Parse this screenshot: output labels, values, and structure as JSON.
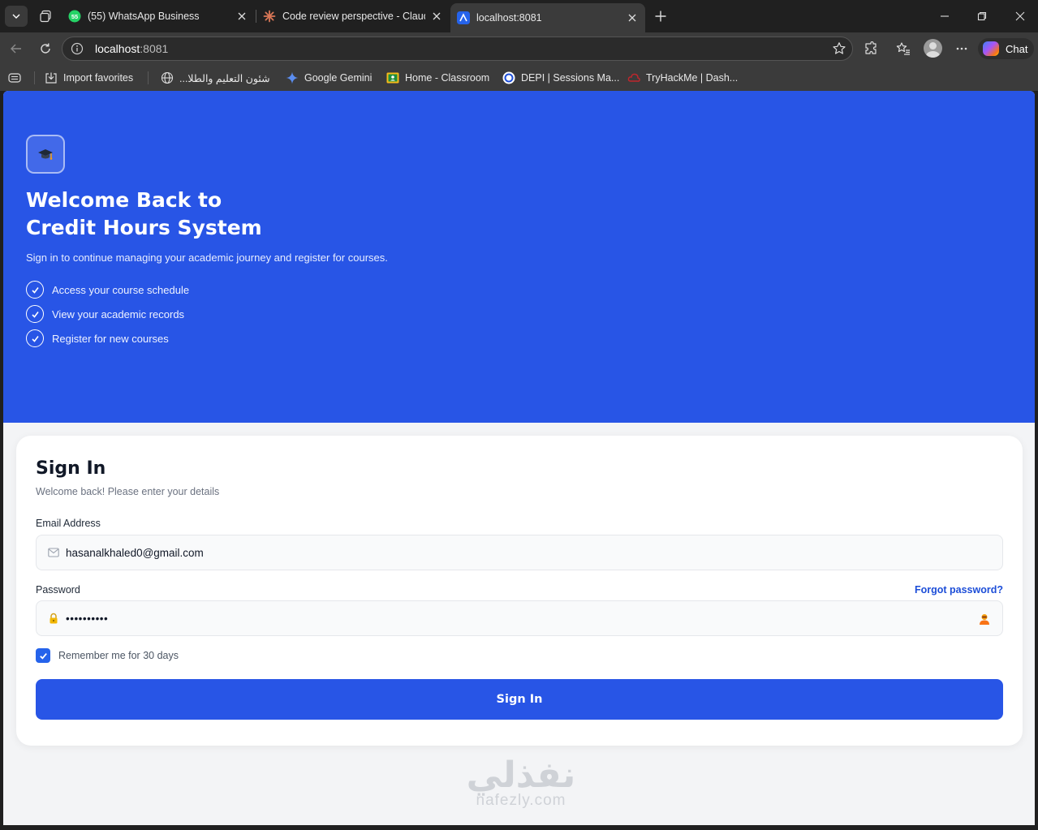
{
  "browser": {
    "tabs": [
      {
        "title": "(55) WhatsApp Business",
        "badge": "55"
      },
      {
        "title": "Code review perspective - Claude"
      },
      {
        "title": "localhost:8081",
        "active": true
      }
    ],
    "address": {
      "host": "localhost",
      "port": ":8081"
    },
    "chat_label": "Chat",
    "bookmarks": [
      {
        "label": "Import favorites",
        "icon": "import-icon"
      },
      {
        "label": "شئون التعليم والطلا...",
        "icon": "globe-icon"
      },
      {
        "label": "Google Gemini",
        "icon": "gemini-icon"
      },
      {
        "label": "Home - Classroom",
        "icon": "classroom-icon"
      },
      {
        "label": "DEPI | Sessions Ma...",
        "icon": "depi-icon"
      },
      {
        "label": "TryHackMe | Dash...",
        "icon": "tryhackme-icon"
      }
    ]
  },
  "hero": {
    "title_line1": "Welcome Back to",
    "title_line2": "Credit Hours System",
    "subtitle": "Sign in to continue managing your academic journey and register for courses.",
    "features": [
      "Access your course schedule",
      "View your academic records",
      "Register for new courses"
    ],
    "colors": {
      "background": "#2855e6"
    }
  },
  "signin": {
    "title": "Sign In",
    "subtitle": "Welcome back! Please enter your details",
    "email_label": "Email Address",
    "email_value": "hasanalkhaled0@gmail.com",
    "password_label": "Password",
    "forgot_label": "Forgot password?",
    "password_mask": "••••••••••",
    "remember_label": "Remember me for 30 days",
    "remember_checked": true,
    "button_label": "Sign In",
    "colors": {
      "accent": "#2855e6",
      "link": "#1d4ed8"
    }
  },
  "watermark": {
    "arabic": "نفذلي",
    "latin": "nafezly.com"
  }
}
